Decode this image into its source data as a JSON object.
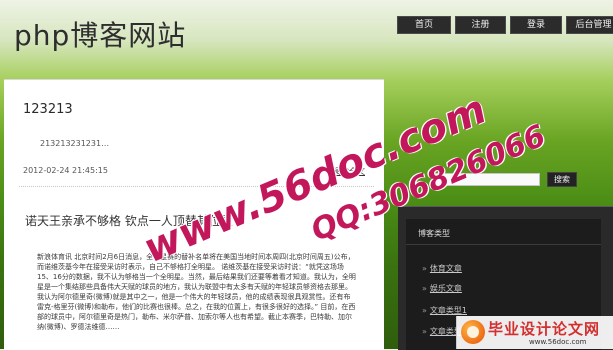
{
  "site": {
    "title": "php博客网站"
  },
  "nav": {
    "items": [
      "首页",
      "注册",
      "登录",
      "后台管理"
    ]
  },
  "post": {
    "title": "123213",
    "excerpt": "213213231231…",
    "date": "2012-02-24 21:45:15",
    "read_more": "阅读全文"
  },
  "news": {
    "title": "诺天王亲承不够格 钦点一人顶替其位置",
    "body": "新浪体育讯 北京时间2月6日消息，全明星赛的替补名单将在美国当地时间本周四(北京时间周五)公布，而诺维茨基今年在接受采访时表示，自己不够格打全明星。 诺维茨基在接受采访时说：“就凭这场场15、16分的数据，我不认为够格当一个全明星。当然，最后结果我们还要等着看才知道。我认为，全明星是一个集结那些具备伟大天赋的球员的地方，我认为联盟中有太多有天赋的年轻球员够资格去那里。我认为阿尔德里奇(微博)就是其中之一，他是一个伟大的年轻球员，他的成绩表现很具观赏性。还有布雷克-格里芬(微博)和勒布，他们的比赛也很棒。总之，在我的位置上，有很多很好的选择。” 目前，在西部的球员中，阿尔德里奇是热门，勒布、米尔萨普、加索尔等人也有希望。截止本赛季，巴特勒、加尔纳(微博)、罗德法维德……"
  },
  "search": {
    "placeholder": "",
    "button_label": "搜索"
  },
  "sidebar": {
    "category_title": "博客类型",
    "categories": [
      {
        "label": "体育文章"
      },
      {
        "label": "娱乐文章"
      },
      {
        "label": "文章类型1"
      },
      {
        "label": "文章类型2"
      }
    ]
  },
  "watermark": {
    "text1": "www.56doc.com",
    "text2": "QQ:306826066"
  },
  "badge": {
    "title": "毕业设计论文网",
    "url": "www.56doc.com"
  }
}
